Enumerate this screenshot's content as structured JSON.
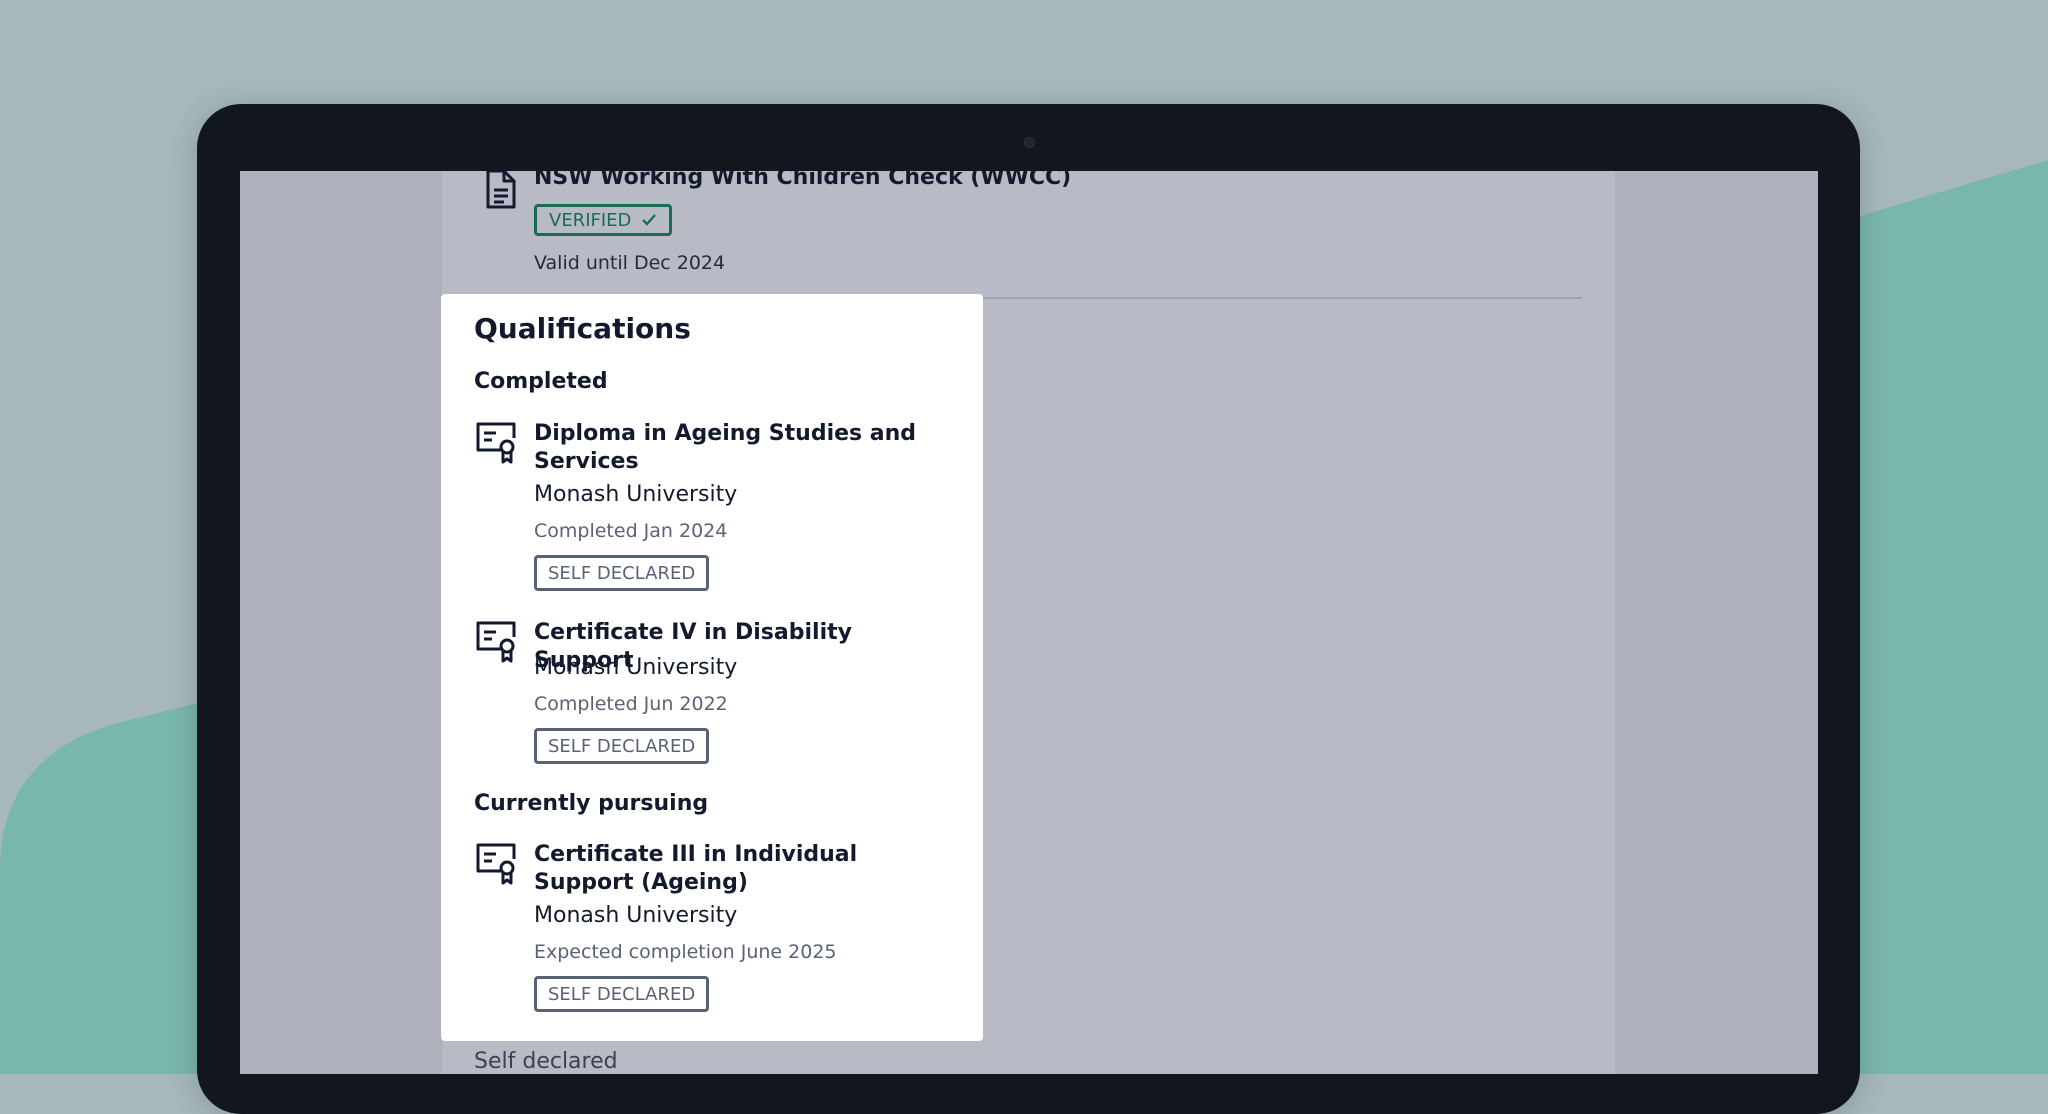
{
  "colors": {
    "background": "#a6b8bc",
    "accent_teal": "#79b7aa",
    "laptop_frame": "#12161f",
    "verified_green": "#1b6b53",
    "text_dark": "#141a2e",
    "text_muted": "#5a6275"
  },
  "wwcc": {
    "title": "NSW Working With Children Check (WWCC)",
    "badge_label": "VERIFIED",
    "valid_text": "Valid until Dec 2024",
    "icon": "document-icon"
  },
  "qualifications": {
    "title": "Qualifications",
    "completed_label": "Completed",
    "pursuing_label": "Currently pursuing",
    "completed": [
      {
        "title": "Diploma in Ageing Studies and Services",
        "institution": "Monash University",
        "date": "Completed Jan 2024",
        "badge": "SELF DECLARED",
        "icon": "certificate-icon"
      },
      {
        "title": "Certificate IV in Disability Support",
        "institution": "Monash University",
        "date": "Completed Jun 2022",
        "badge": "SELF DECLARED",
        "icon": "certificate-icon"
      }
    ],
    "pursuing": [
      {
        "title": "Certificate III in Individual Support (Ageing)",
        "institution": "Monash University",
        "date": "Expected completion June 2025",
        "badge": "SELF DECLARED",
        "icon": "certificate-icon"
      }
    ]
  },
  "footer_text": "Self declared"
}
